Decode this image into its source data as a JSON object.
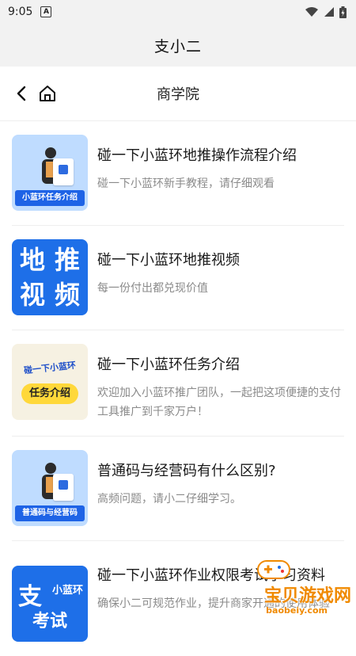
{
  "status_bar": {
    "time": "9:05",
    "notification_letter": "A"
  },
  "app_bar": {
    "title": "支小二"
  },
  "nav": {
    "title": "商学院"
  },
  "items": [
    {
      "title": "碰一下小蓝环地推操作流程介绍",
      "subtitle": "碰一下小蓝环新手教程，请仔细观看",
      "thumb_text": "小蓝环任务介绍"
    },
    {
      "title": "碰一下小蓝环地推视频",
      "subtitle": "每一份付出都兑现价值",
      "thumb_chars": [
        "地",
        "推",
        "视",
        "频"
      ]
    },
    {
      "title": "碰一下小蓝环任务介绍",
      "subtitle": "欢迎加入小蓝环推广团队，一起把这项便捷的支付工具推广到千家万户！",
      "thumb_line1": "碰一下小蓝环",
      "thumb_pill": "任务介绍"
    },
    {
      "title": "普通码与经营码有什么区别?",
      "subtitle": "高频问题，请小二仔细学习。",
      "thumb_text": "普通码与经营码"
    },
    {
      "title": "碰一下小蓝环作业权限考试学习资料",
      "subtitle": "确保小二可规范作业，提升商家开通的使用体验",
      "thumb_big": "支",
      "thumb_small": "小蓝环",
      "thumb_bottom": "考试"
    }
  ],
  "watermark": {
    "text": "宝贝游戏网",
    "url": "baobeiy.com"
  },
  "colors": {
    "accent_blue": "#1e6fe8",
    "watermark_orange": "#f08a00"
  }
}
